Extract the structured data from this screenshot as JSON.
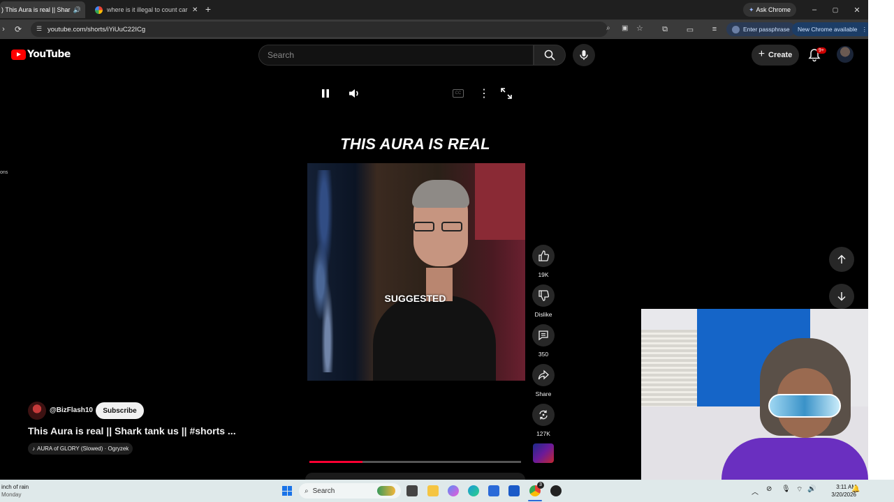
{
  "browser": {
    "tabs": [
      {
        "title": ") This Aura is real || Shar",
        "active": true
      },
      {
        "title": "where is it illegal to count card",
        "active": false
      }
    ],
    "new_tab_symbol": "+",
    "ask_chrome": "Ask Chrome",
    "url": "youtube.com/shorts/iYiUuC22ICg",
    "passphrase_chip": "Enter passphrase",
    "update_chip": "New Chrome available",
    "window_controls": {
      "minimize": "–",
      "restore": "▢",
      "close": "✕"
    }
  },
  "youtube": {
    "logo_text": "YouTube",
    "search_placeholder": "Search",
    "create_label": "Create",
    "notification_badge": "9+"
  },
  "left_edge": {
    "text": "ons"
  },
  "short": {
    "caption_top": "THIS AURA IS REAL",
    "caption_mid": "SUGGESTED",
    "progress": 0.25,
    "actions": {
      "likes": "19K",
      "dislike": "Dislike",
      "comments": "350",
      "share": "Share",
      "remix": "127K"
    },
    "channel": "@BizFlash10",
    "subscribe_label": "Subscribe",
    "title": "This Aura is real || Shark tank us || #shorts ...",
    "music": "AURA of GLORY (Slowed) · Ogryzek"
  },
  "taskbar": {
    "weather_line1": "inch of rain",
    "weather_line2": "Monday",
    "search_label": "Search",
    "time": "3:11 AM",
    "date": "3/20/2026",
    "chrome_badge": "3"
  },
  "colors": {
    "accent_red": "#ff0033",
    "youtube_red": "#ff0000",
    "taskbar_bg": "#dfe9ea"
  }
}
